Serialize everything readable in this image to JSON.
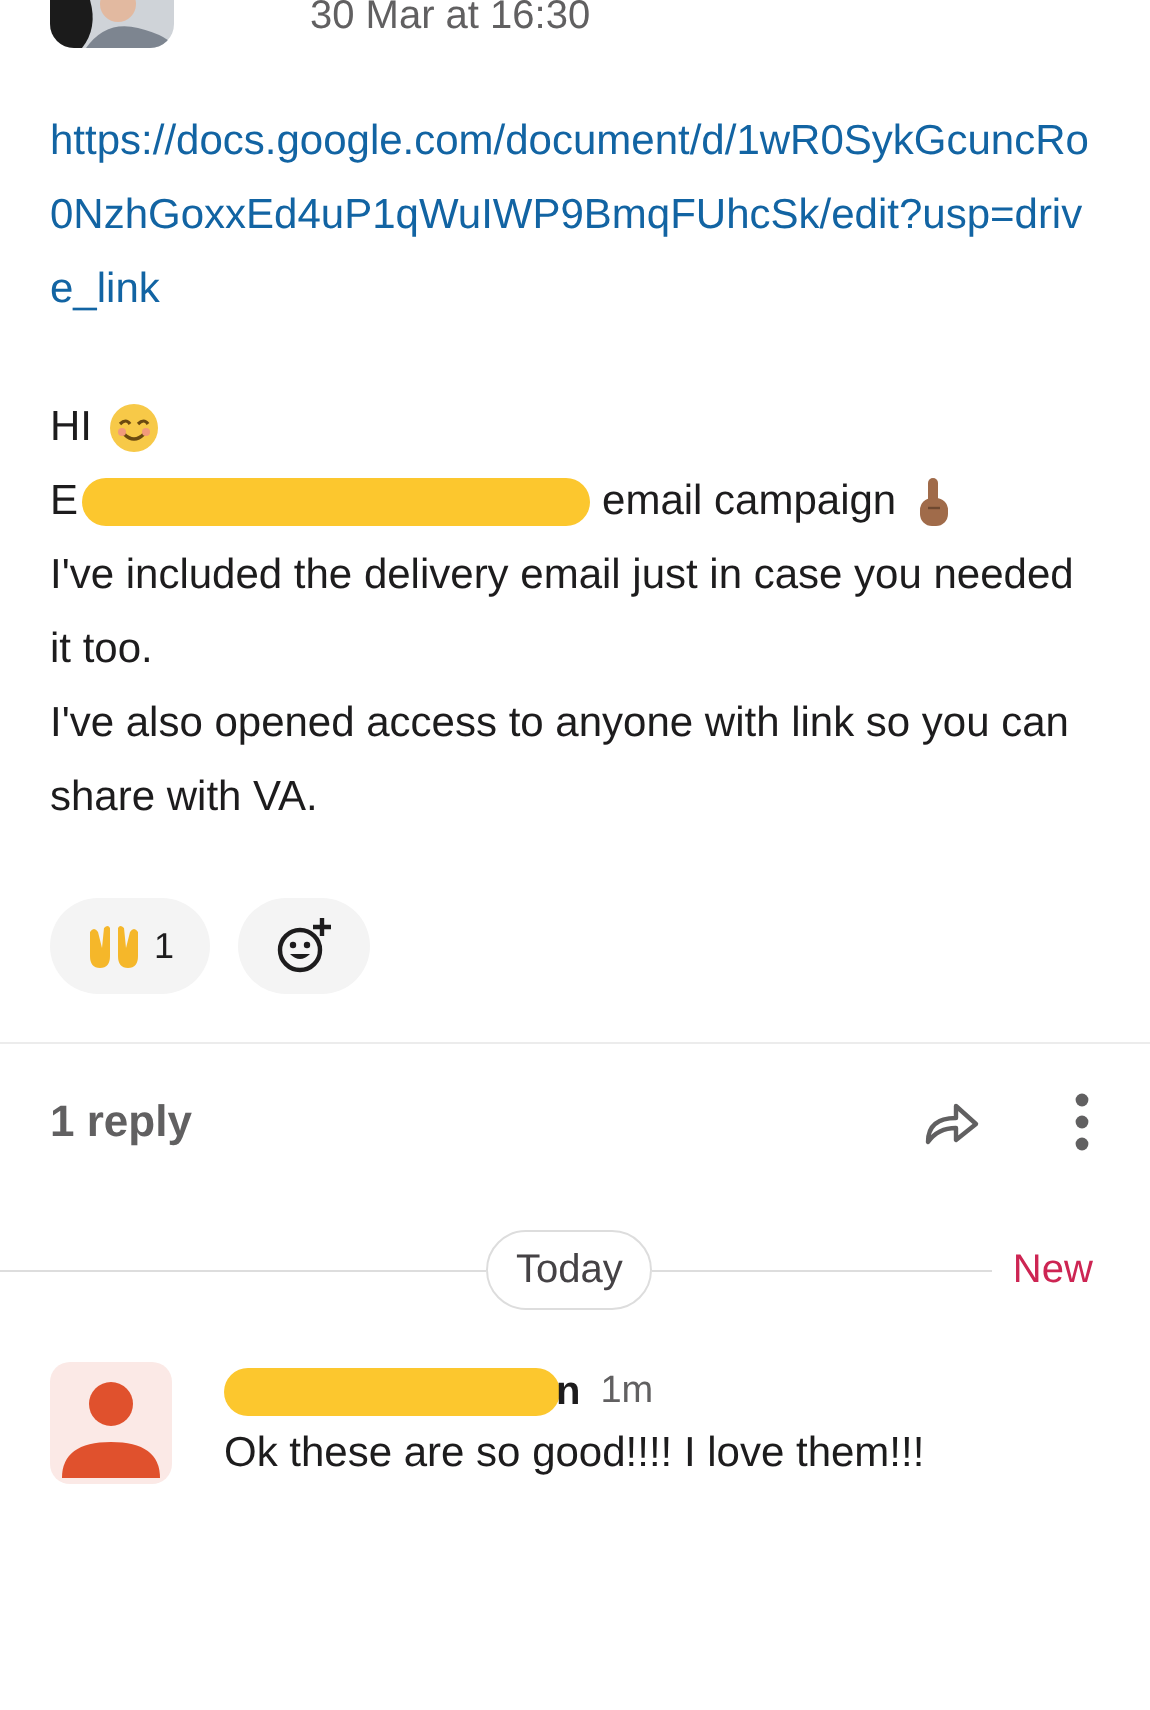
{
  "message": {
    "timestamp": "30 Mar at 16:30",
    "link": "https://docs.google.com/document/d/1wR0SykGcuncRo0NzhGoxxEd4uP1qWuIWP9BmqFUhcSk/edit?usp=drive_link",
    "greeting": "HI",
    "redacted_line": {
      "before": "E",
      "after": "email campaign"
    },
    "paragraphs": [
      "I've included the delivery email just in case you needed it too.",
      "I've also opened access to anyone with link so you can share with VA."
    ],
    "reactions": [
      {
        "count": "1",
        "selected": false
      }
    ]
  },
  "thread": {
    "reply_count": "1 reply"
  },
  "divider": {
    "label": "Today",
    "new_label": "New"
  },
  "reply": {
    "name_fragment": "n",
    "time": "1m",
    "text": "Ok these are so good!!!! I love them!!!"
  }
}
